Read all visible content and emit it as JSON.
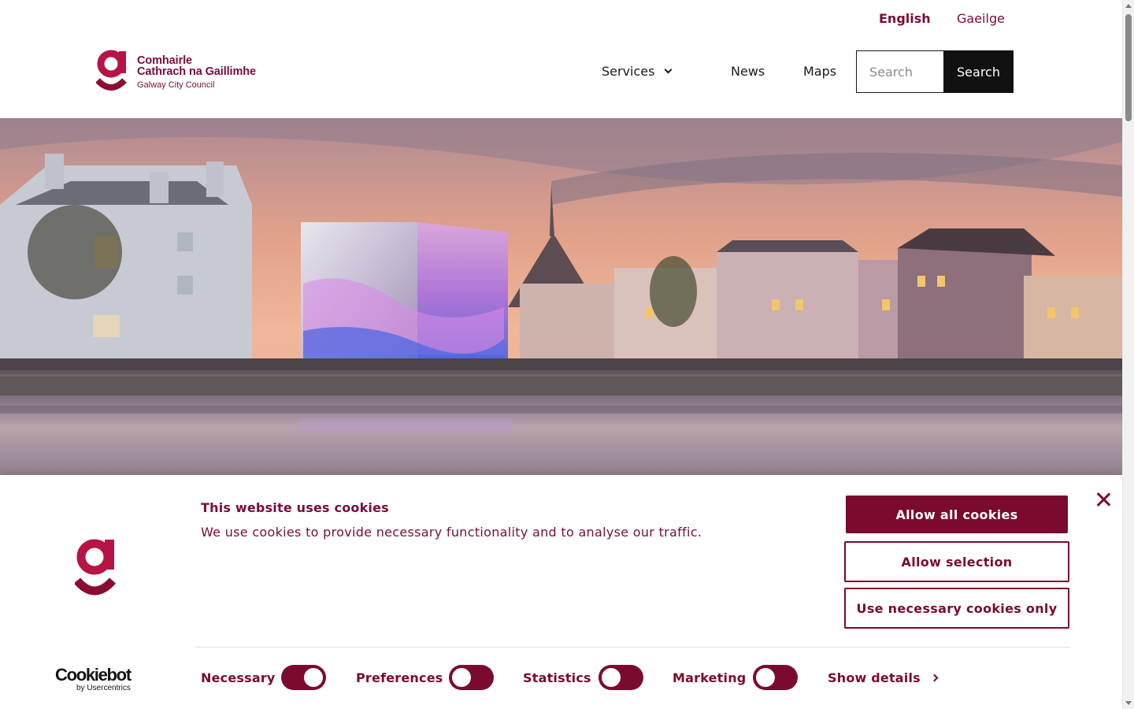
{
  "header": {
    "languages": [
      "English",
      "Gaeilge"
    ],
    "logo": {
      "line1": "Comhairle",
      "line2": "Cathrach na Gaillimhe",
      "line3": "Galway City Council"
    },
    "nav": {
      "services": "Services",
      "news": "News",
      "maps": "Maps"
    },
    "search": {
      "placeholder": "Search",
      "button": "Search"
    }
  },
  "cookie_banner": {
    "title": "This website uses cookies",
    "description": "We use cookies to provide necessary functionality and to analyse our traffic.",
    "buttons": {
      "allow_all": "Allow all cookies",
      "allow_selection": "Allow selection",
      "necessary_only": "Use necessary cookies only"
    },
    "toggles": [
      {
        "label": "Necessary",
        "on": true
      },
      {
        "label": "Preferences",
        "on": false
      },
      {
        "label": "Statistics",
        "on": false
      },
      {
        "label": "Marketing",
        "on": false
      }
    ],
    "show_details": "Show details",
    "brand": {
      "name": "Cookiebot",
      "sub": "by Usercentrics"
    }
  },
  "colors": {
    "brand": "#7b0b3a",
    "button_dark": "#111111"
  }
}
